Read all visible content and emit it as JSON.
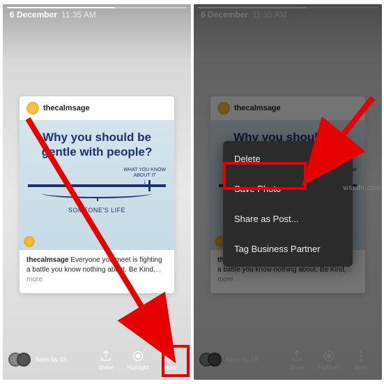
{
  "header": {
    "date": "6 December",
    "time": "11:35 AM"
  },
  "post": {
    "username": "thecalmsage",
    "headline": "Why you should be gentle with people?",
    "know_label_1": "WHAT YOU KNOW",
    "know_label_2": "ABOUT IT",
    "life_label": "SOMEONE'S LIFE",
    "caption_user": "thecalmsage",
    "caption_text": " Everyone you meet is fighting a battle you know nothing about. Be Kind,",
    "caption_more": "... more"
  },
  "bottombar": {
    "seen_by": "Seen by 18",
    "share": "Share",
    "highlight": "Highlight",
    "more": "More"
  },
  "menu": {
    "delete": "Delete",
    "save_photo": "Save Photo",
    "share_post": "Share as Post...",
    "tag_partner": "Tag Business Partner"
  },
  "watermark": "wsxdn.com"
}
